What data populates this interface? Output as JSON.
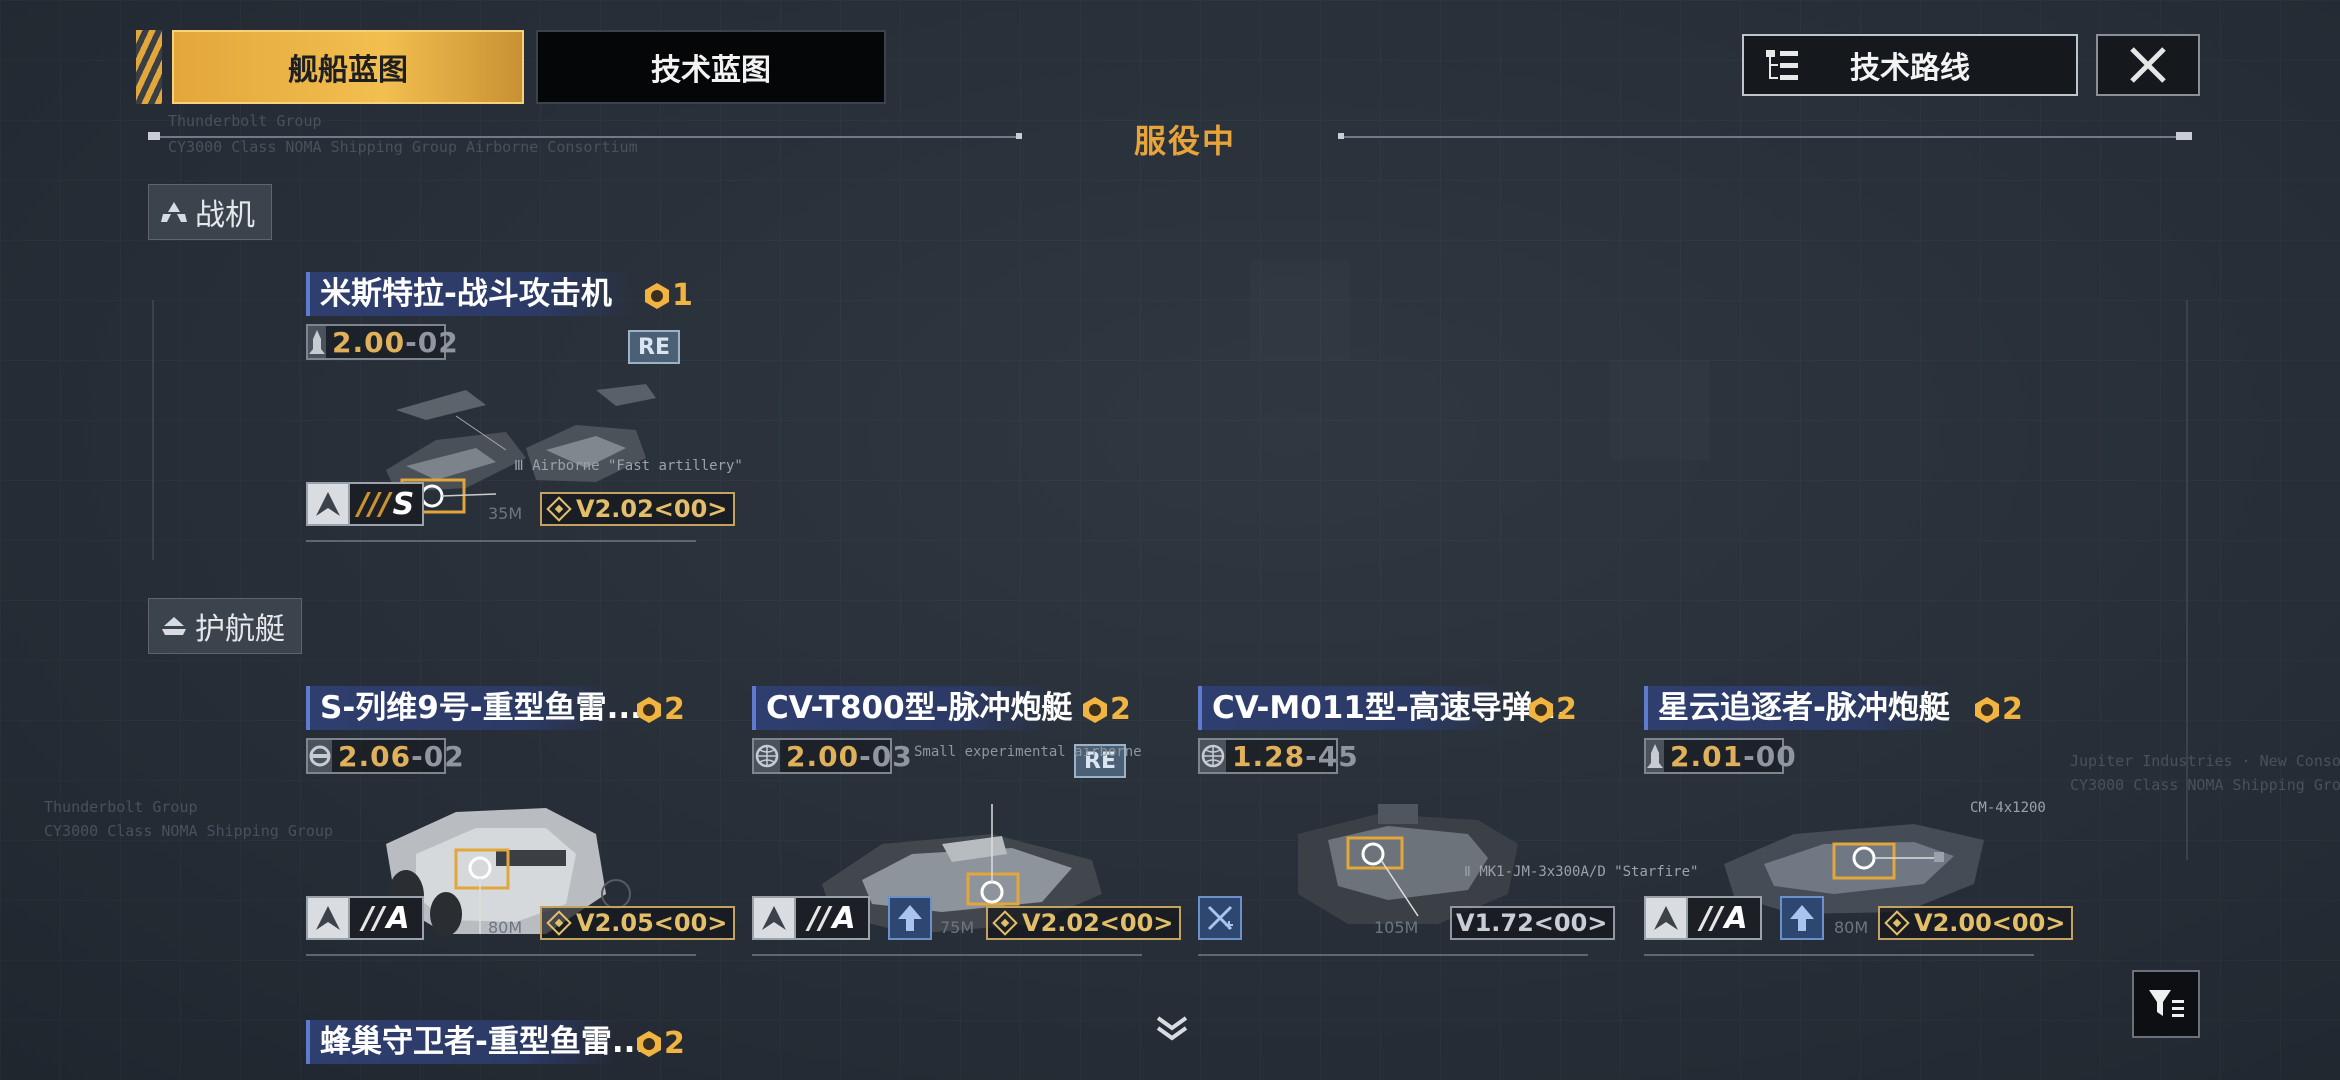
{
  "tabs": [
    {
      "label": "舰船蓝图",
      "active": true
    },
    {
      "label": "技术蓝图",
      "active": false
    }
  ],
  "tech_route_button": {
    "label": "技术路线",
    "icon": "tree-list-icon"
  },
  "close_button": {
    "icon": "close-icon"
  },
  "status_heading": "服役中",
  "colors": {
    "accent": "#f2b441",
    "title_bar": "#2e3e6e",
    "background": "#262d36"
  },
  "sections": [
    {
      "label": "战机",
      "icon": "fighter-wing-icon",
      "cards": [
        {
          "name": "米斯特拉-战斗攻击机",
          "count": "1",
          "stat_main": "2.00",
          "stat_sub": "-02",
          "stat_icon": "rocket-icon",
          "badge": "RE",
          "rank_stripes": "///",
          "rank": "S",
          "scale": "35M",
          "version": "V2.02<00>",
          "version_style": "gold",
          "callout": "Ⅲ Airborne \"Fast artillery\""
        }
      ]
    },
    {
      "label": "护航艇",
      "icon": "escort-ship-icon",
      "cards": [
        {
          "name": "S-列维9号-重型鱼雷...",
          "count": "2",
          "stat_main": "2.06",
          "stat_sub": "-02",
          "stat_icon": "torpedo-icon",
          "badge": "",
          "rank_stripes": "//",
          "rank": "A",
          "scale": "80M",
          "version": "V2.05<00>",
          "version_style": "gold"
        },
        {
          "name": "CV-T800型-脉冲炮艇",
          "count": "2",
          "stat_main": "2.00",
          "stat_sub": "-03",
          "stat_icon": "globe-icon",
          "badge": "RE",
          "rank_stripes": "//",
          "rank": "A",
          "up": true,
          "scale": "75M",
          "version": "V2.02<00>",
          "version_style": "gold",
          "callout": "Small experimental airborne"
        },
        {
          "name": "CV-M011型-高速导弹...",
          "count": "2",
          "stat_main": "1.28",
          "stat_sub": "-45",
          "stat_icon": "globe-icon",
          "badge": "",
          "special_icon": "crossed-swords-icon",
          "scale": "105M",
          "version": "V1.72<00>",
          "version_style": "plain",
          "callout": "Ⅱ MK1-JM-3x300A/D \"Starfire\""
        },
        {
          "name": "星云追逐者-脉冲炮艇",
          "count": "2",
          "stat_main": "2.01",
          "stat_sub": "-00",
          "stat_icon": "rocket-icon",
          "badge": "",
          "rank_stripes": "//",
          "rank": "A",
          "up": true,
          "scale": "80M",
          "version": "V2.00<00>",
          "version_style": "gold",
          "callout": "CM-4x1200"
        }
      ]
    }
  ],
  "next_row_card": {
    "name": "蜂巢守卫者-重型鱼雷...",
    "count": "2"
  },
  "filter_button": {
    "icon": "filter-icon"
  },
  "scroll_hint": {
    "icon": "chevron-down-double-icon"
  }
}
